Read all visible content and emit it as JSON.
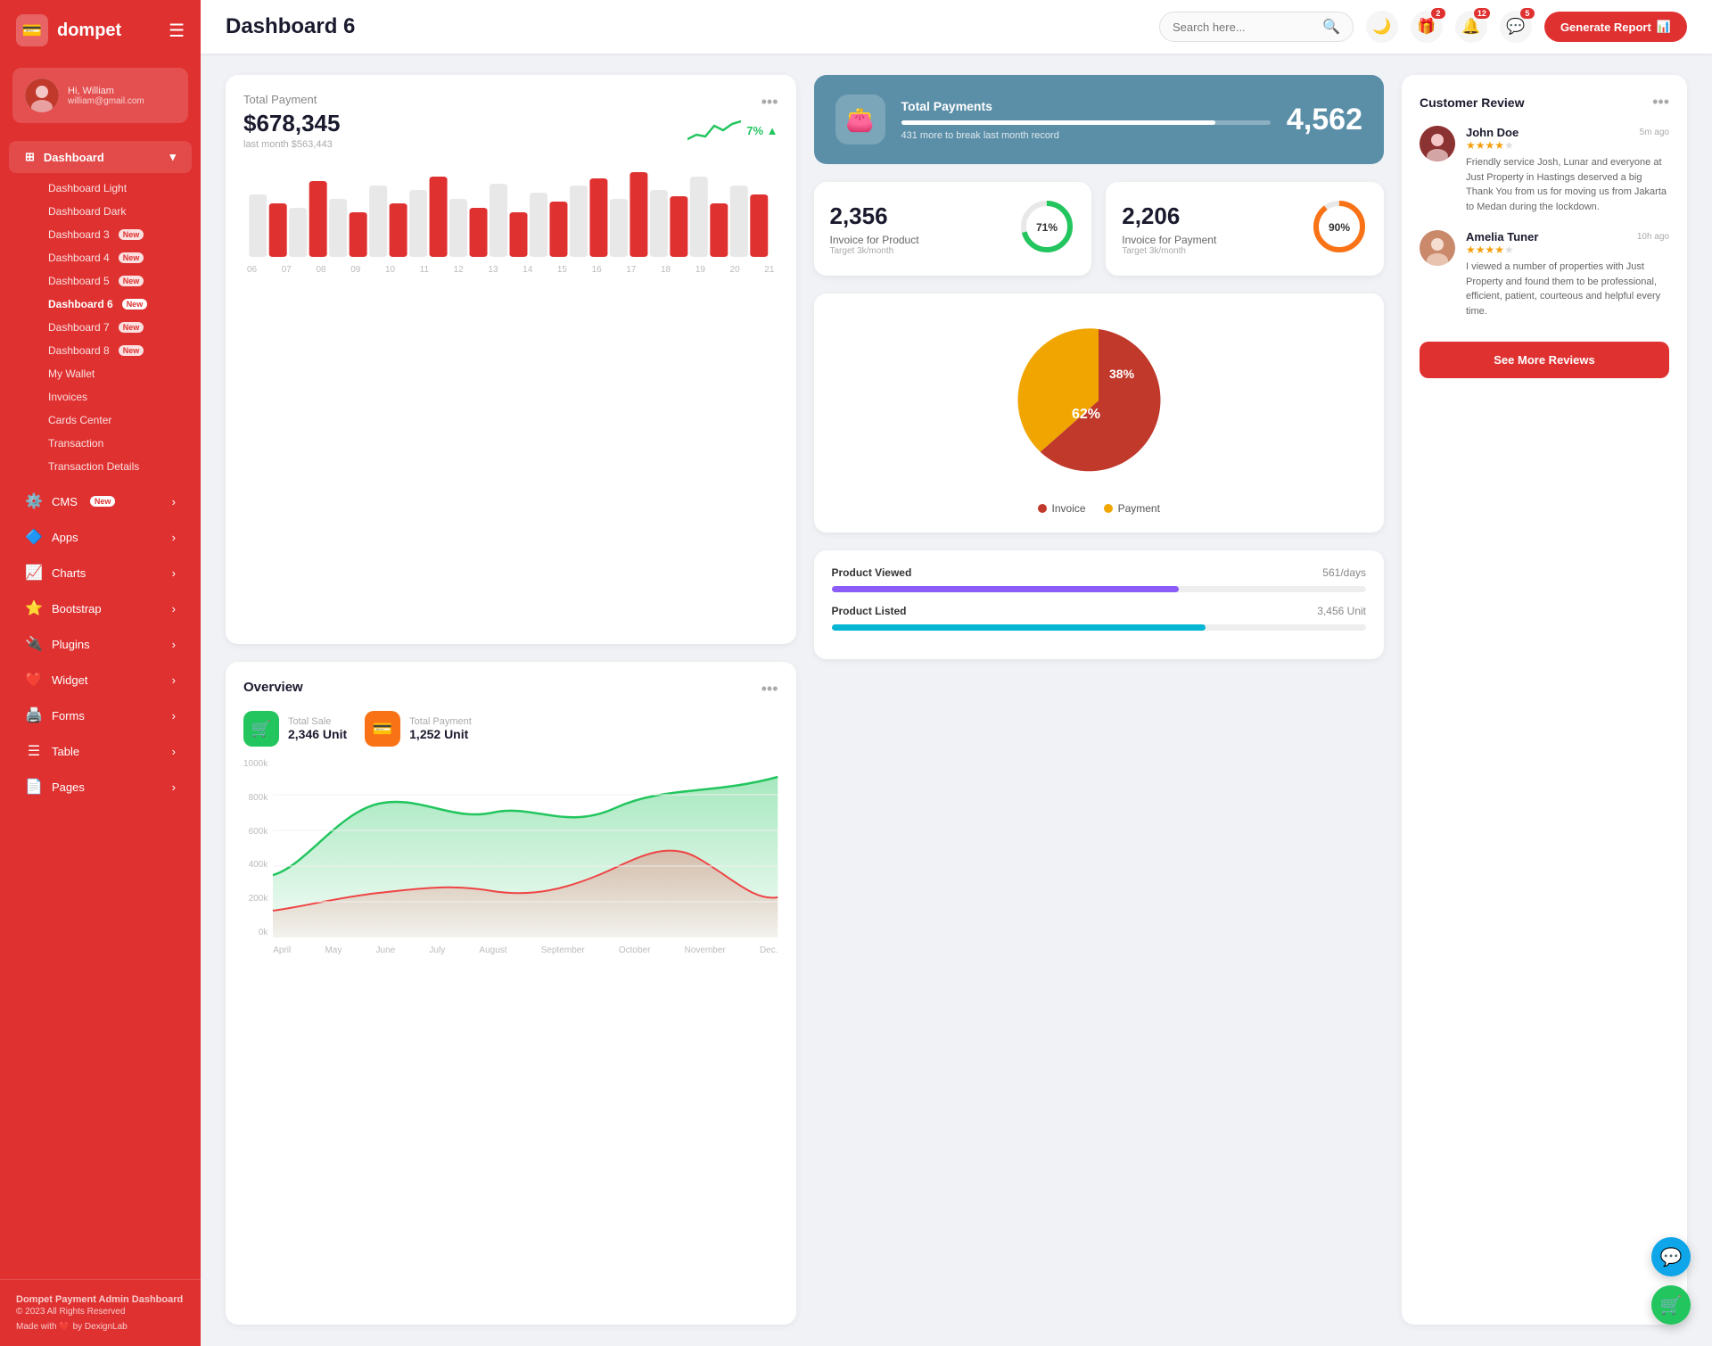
{
  "sidebar": {
    "logo": "dompet",
    "logo_icon": "💳",
    "user": {
      "greeting": "Hi, William",
      "name": "William",
      "email": "william@gmail.com"
    },
    "nav_dashboard": "Dashboard",
    "dashboard_children": [
      {
        "label": "Dashboard Light",
        "new": false,
        "active": false
      },
      {
        "label": "Dashboard Dark",
        "new": false,
        "active": false
      },
      {
        "label": "Dashboard 3",
        "new": true,
        "active": false
      },
      {
        "label": "Dashboard 4",
        "new": true,
        "active": false
      },
      {
        "label": "Dashboard 5",
        "new": true,
        "active": false
      },
      {
        "label": "Dashboard 6",
        "new": true,
        "active": true
      },
      {
        "label": "Dashboard 7",
        "new": true,
        "active": false
      },
      {
        "label": "Dashboard 8",
        "new": true,
        "active": false
      },
      {
        "label": "My Wallet",
        "new": false,
        "active": false
      },
      {
        "label": "Invoices",
        "new": false,
        "active": false
      },
      {
        "label": "Cards Center",
        "new": false,
        "active": false
      },
      {
        "label": "Transaction",
        "new": false,
        "active": false
      },
      {
        "label": "Transaction Details",
        "new": false,
        "active": false
      }
    ],
    "nav_items": [
      {
        "label": "CMS",
        "new": true,
        "icon": "⚙️",
        "has_arrow": true
      },
      {
        "label": "Apps",
        "new": false,
        "icon": "🟦",
        "has_arrow": true
      },
      {
        "label": "Charts",
        "new": false,
        "icon": "📊",
        "has_arrow": true
      },
      {
        "label": "Bootstrap",
        "new": false,
        "icon": "⭐",
        "has_arrow": true
      },
      {
        "label": "Plugins",
        "new": false,
        "icon": "🔌",
        "has_arrow": true
      },
      {
        "label": "Widget",
        "new": false,
        "icon": "❤️",
        "has_arrow": true
      },
      {
        "label": "Forms",
        "new": false,
        "icon": "🖨️",
        "has_arrow": true
      },
      {
        "label": "Table",
        "new": false,
        "icon": "☰",
        "has_arrow": true
      },
      {
        "label": "Pages",
        "new": false,
        "icon": "📄",
        "has_arrow": true
      }
    ],
    "footer": {
      "brand": "Dompet Payment Admin Dashboard",
      "copy": "© 2023 All Rights Reserved",
      "made": "Made with ❤️ by DexignLab"
    }
  },
  "topbar": {
    "page_title": "Dashboard 6",
    "search_placeholder": "Search here...",
    "badges": {
      "gift": "2",
      "bell": "12",
      "chat": "5"
    },
    "generate_btn": "Generate Report"
  },
  "total_payment": {
    "title": "Total Payment",
    "amount": "$678,345",
    "last_month_label": "last month $563,443",
    "trend": "7%",
    "bars": [
      3,
      7,
      5,
      9,
      6,
      4,
      8,
      5,
      7,
      9,
      6,
      5,
      8,
      4,
      7,
      5
    ],
    "labels": [
      "06",
      "07",
      "08",
      "09",
      "10",
      "11",
      "12",
      "13",
      "14",
      "15",
      "16",
      "17",
      "18",
      "19",
      "20",
      "21"
    ]
  },
  "total_payments_blue": {
    "title": "Total Payments",
    "number": "4,562",
    "sub": "431 more to break last month record",
    "progress": 85
  },
  "invoice_product": {
    "number": "2,356",
    "label": "Invoice for Product",
    "sub": "Target 3k/month",
    "percent": 71,
    "color": "#22c55e"
  },
  "invoice_payment": {
    "number": "2,206",
    "label": "Invoice for Payment",
    "sub": "Target 3k/month",
    "percent": 90,
    "color": "#f97316"
  },
  "overview": {
    "title": "Overview",
    "total_sale_label": "Total Sale",
    "total_sale_value": "2,346 Unit",
    "total_payment_label": "Total Payment",
    "total_payment_value": "1,252 Unit",
    "y_labels": [
      "1000k",
      "800k",
      "600k",
      "400k",
      "200k",
      "0k"
    ],
    "x_labels": [
      "April",
      "May",
      "June",
      "July",
      "August",
      "September",
      "October",
      "November",
      "Dec."
    ]
  },
  "pie_chart": {
    "invoice_pct": 62,
    "payment_pct": 38,
    "invoice_label": "Invoice",
    "payment_label": "Payment",
    "invoice_color": "#c0392b",
    "payment_color": "#f0a500"
  },
  "product_viewed": {
    "label": "Product Viewed",
    "value": "561/days",
    "color": "#8b5cf6",
    "fill_pct": 65
  },
  "product_listed": {
    "label": "Product Listed",
    "value": "3,456 Unit",
    "color": "#06b6d4",
    "fill_pct": 70
  },
  "customer_review": {
    "title": "Customer Review",
    "reviews": [
      {
        "name": "John Doe",
        "stars": 4,
        "time": "5m ago",
        "text": "Friendly service Josh, Lunar and everyone at Just Property in Hastings deserved a big Thank You from us for moving us from Jakarta to Medan during the lockdown.",
        "avatar_color": "#c0392b"
      },
      {
        "name": "Amelia Tuner",
        "stars": 4,
        "time": "10h ago",
        "text": "I viewed a number of properties with Just Property and found them to be professional, efficient, patient, courteous and helpful every time.",
        "avatar_color": "#d4a5a5"
      }
    ],
    "see_more_btn": "See More Reviews"
  },
  "float_btns": {
    "support_icon": "💬",
    "cart_icon": "🛒"
  }
}
